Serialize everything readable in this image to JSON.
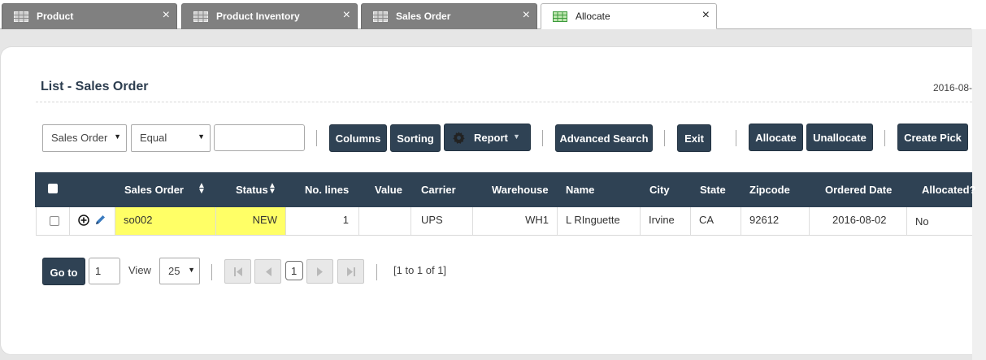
{
  "tabs": [
    {
      "label": "Product",
      "close": "×"
    },
    {
      "label": "Product Inventory",
      "close": "×"
    },
    {
      "label": "Sales Order",
      "close": "×"
    },
    {
      "label": "Allocate",
      "close": "×"
    }
  ],
  "page": {
    "title": "List - Sales Order",
    "date": "2016-08-"
  },
  "filters": {
    "field": "Sales Order",
    "operator": "Equal",
    "value": ""
  },
  "toolbar": {
    "columns": "Columns",
    "sorting": "Sorting",
    "report": "Report",
    "advanced_search": "Advanced Search",
    "exit": "Exit",
    "allocate": "Allocate",
    "unallocate": "Unallocate",
    "create_pick": "Create Pick"
  },
  "table": {
    "headers": [
      "Sales Order",
      "Status",
      "No. lines",
      "Value",
      "Carrier",
      "Warehouse",
      "Name",
      "City",
      "State",
      "Zipcode",
      "Ordered Date",
      "Allocated?"
    ],
    "rows": [
      {
        "sales_order": "so002",
        "status": "NEW",
        "no_lines": "1",
        "value": "",
        "carrier": "UPS",
        "warehouse": "WH1",
        "name": "L RInguette",
        "city": "Irvine",
        "state": "CA",
        "zipcode": "92612",
        "ordered_date": "2016-08-02",
        "allocated": "No"
      }
    ],
    "highlight_color": "#ffff66"
  },
  "pager": {
    "goto_label": "Go to",
    "goto_value": "1",
    "view_label": "View",
    "page_size": "25",
    "current_page": "1",
    "summary": "[1 to 1 of 1]"
  },
  "colors": {
    "header_bg": "#2f4254",
    "button_bg": "#2f4254",
    "tab_inactive": "#808080"
  }
}
